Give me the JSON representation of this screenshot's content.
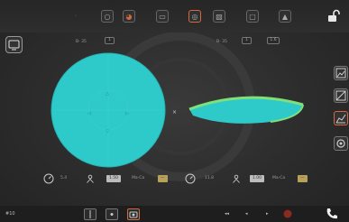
{
  "colors": {
    "accent": "#d26a3c",
    "fill": "#2ec9c9",
    "fill_edge": "#7fe07a"
  },
  "top_left_value": "B- 35",
  "top_left_box": "1",
  "top_right_value": "B- 35",
  "top_right_box1": "1",
  "top_right_box2": "1.6",
  "stats": {
    "left_value": "5.4",
    "left_chip": "1.50",
    "left_label": "Ma-Ca",
    "left_chip2": "—",
    "right_value": "11.8",
    "right_chip": "1.00",
    "right_label": "Ma-Ca",
    "right_chip2": "—"
  },
  "bottom": {
    "left_label": "#10",
    "nav_left": "◂◂",
    "nav_mid": "◂",
    "nav_right": "▸"
  },
  "icons": {
    "lock": "unlock-icon",
    "phone": "phone-icon"
  }
}
